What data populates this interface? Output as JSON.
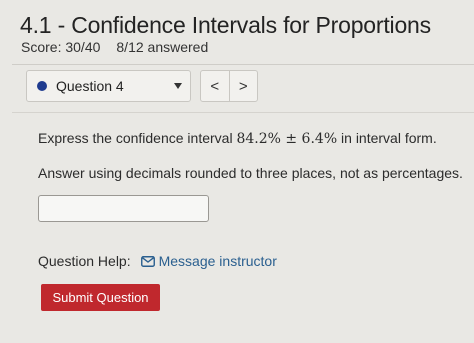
{
  "page": {
    "title": "4.1 - Confidence Intervals for Proportions",
    "score": "Score: 30/40",
    "answered": "8/12 answered"
  },
  "question_nav": {
    "selected": "Question 4",
    "prev_label": "<",
    "next_label": ">"
  },
  "question": {
    "prompt_prefix": "Express the confidence interval ",
    "prompt_math": "84.2% ± 6.4%",
    "prompt_suffix": " in interval form.",
    "instruction": "Answer using decimals rounded to three places, not as percentages.",
    "answer_value": ""
  },
  "help": {
    "label": "Question Help:",
    "message_link": "Message instructor"
  },
  "actions": {
    "submit_label": "Submit Question"
  },
  "colors": {
    "accent_dot": "#1f3b8f",
    "submit_bg": "#c0282d",
    "link": "#2a5f8f"
  }
}
